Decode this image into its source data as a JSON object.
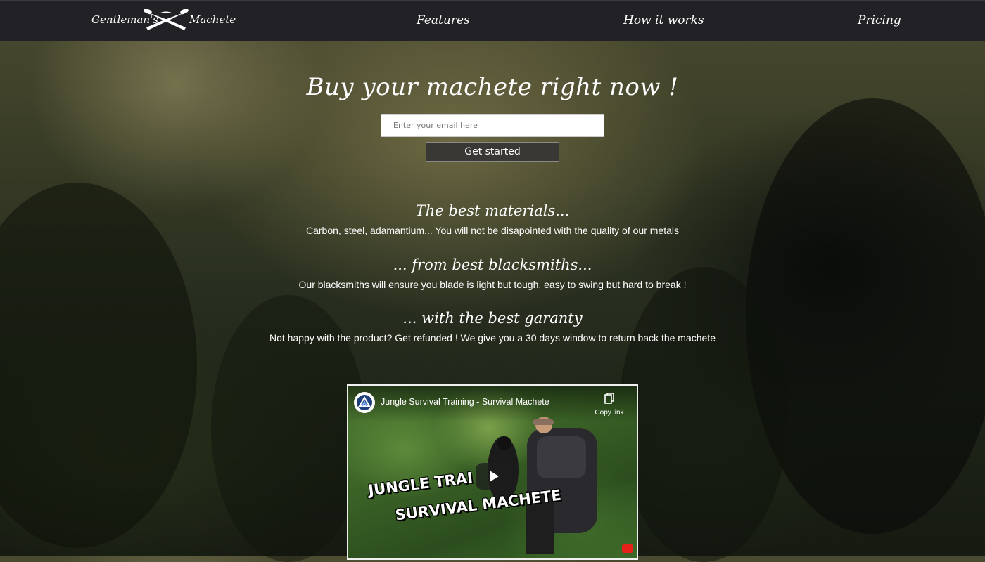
{
  "brand": {
    "word_left": "Gentleman's",
    "word_right": "Machete",
    "logo_icon": "crossed-machetes-icon"
  },
  "nav": {
    "items": [
      {
        "label": "Features"
      },
      {
        "label": "How it works"
      },
      {
        "label": "Pricing"
      }
    ]
  },
  "hero": {
    "title": "Buy your machete right now !",
    "email_placeholder": "Enter your email here",
    "button_label": "Get started"
  },
  "features": [
    {
      "title": "The best materials...",
      "text": "Carbon, steel, adamantium... You will not be disapointed with the quality of our metals"
    },
    {
      "title": "... from best blacksmiths...",
      "text": "Our blacksmiths will ensure you blade is light but tough, easy to swing but hard to break !"
    },
    {
      "title": "... with the best garanty",
      "text": "Not happy with the product? Get refunded ! We give you a 30 days window to return back the machete"
    }
  ],
  "video": {
    "title": "Jungle Survival Training - Survival Machete",
    "copy_link_label": "Copy link",
    "overlay_line1": "JUNGLE TRAI",
    "overlay_line2": "SURVIVAL MACHETE",
    "icons": {
      "channel": "channel-avatar-icon",
      "copy": "copy-icon",
      "play": "play-icon",
      "youtube": "youtube-logo-icon"
    }
  },
  "colors": {
    "navbar": "#222125",
    "button_bg": "#3a3835",
    "text": "#ffffff"
  }
}
